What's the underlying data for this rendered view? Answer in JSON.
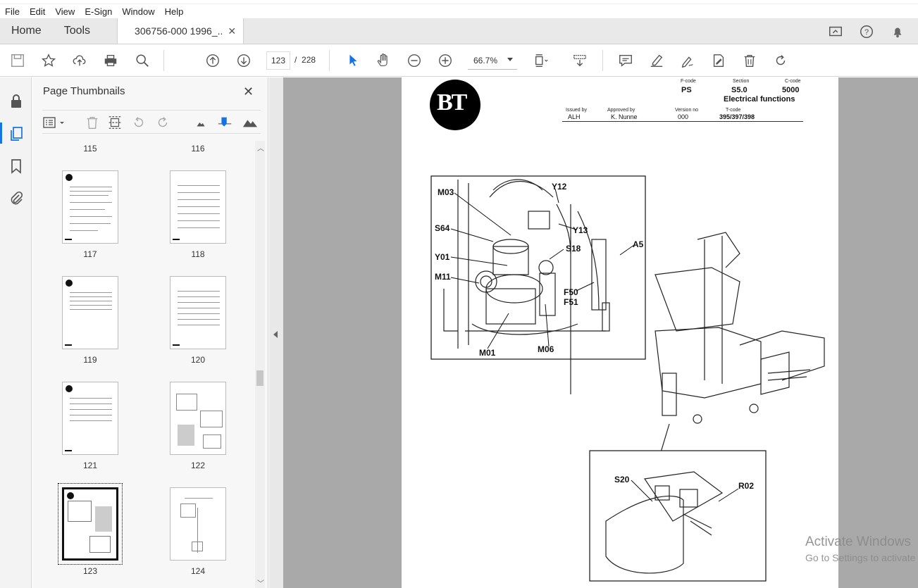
{
  "menu": [
    "File",
    "Edit",
    "View",
    "E-Sign",
    "Window",
    "Help"
  ],
  "tabs": {
    "home": "Home",
    "tools": "Tools",
    "document": "306756-000 1996_...",
    "close": "✕"
  },
  "toolbar": {
    "current_page": "123",
    "separator": "/",
    "total_pages": "228",
    "zoom": "66.7%"
  },
  "panel": {
    "title": "Page Thumbnails",
    "close": "✕",
    "top_labels": [
      "115",
      "116"
    ],
    "thumbnails": [
      {
        "label": "117"
      },
      {
        "label": "118"
      },
      {
        "label": "119"
      },
      {
        "label": "120"
      },
      {
        "label": "121"
      },
      {
        "label": "122"
      },
      {
        "label": "123",
        "selected": true
      },
      {
        "label": "124"
      }
    ]
  },
  "document_page": {
    "header": {
      "fcode_label": "F-code",
      "fcode": "PS",
      "section_label": "Section",
      "section": "S5.0",
      "ccode_label": "C-code",
      "ccode": "5000",
      "subtitle": "Electrical functions",
      "issued_label": "Issued by",
      "issued": "ALH",
      "approved_label": "Approved by",
      "approved": "K. Nunne",
      "version_label": "Version no",
      "version": "000",
      "tcode_label": "T-code",
      "tcode": "395/397/398"
    },
    "logo_text": "BT",
    "callouts": [
      "M03",
      "Y12",
      "Y13",
      "S64",
      "S18",
      "A5",
      "Y01",
      "M11",
      "F50",
      "F51",
      "M01",
      "M06",
      "S20",
      "R02"
    ]
  },
  "watermark": {
    "line1": "Activate Windows",
    "line2": "Go to Settings to activate"
  },
  "icons": [
    "save-icon",
    "star-icon",
    "upload-icon",
    "print-icon",
    "zoom-search-icon",
    "page-up-icon",
    "page-down-icon",
    "select-arrow-icon",
    "hand-icon",
    "zoom-out-icon",
    "zoom-in-icon",
    "fit-page-icon",
    "scroll-mode-icon",
    "comment-icon",
    "highlight-icon",
    "sign-icon",
    "edit-icon",
    "delete-icon",
    "rotate-icon",
    "lock-icon",
    "pages-icon",
    "bookmark-icon",
    "attachment-icon",
    "share-icon",
    "help-icon",
    "bell-icon"
  ]
}
